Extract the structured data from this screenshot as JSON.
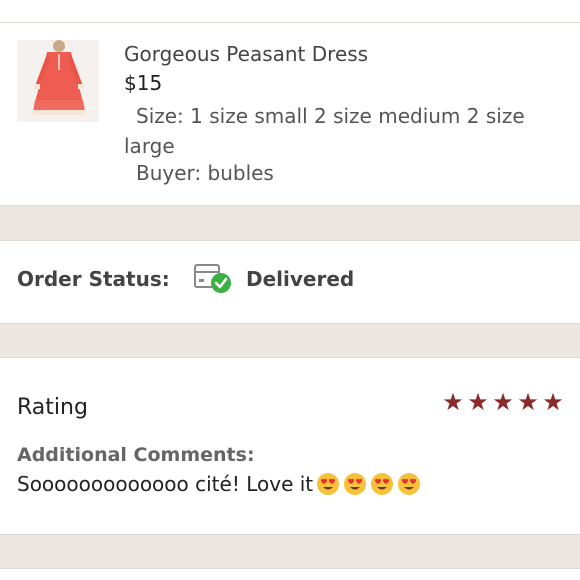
{
  "item": {
    "title": "Gorgeous Peasant Dress",
    "price": "$15",
    "size_line1": "Size: 1 size small 2 size medium 2 size",
    "size_line2": "large",
    "buyer": "Buyer: bubles"
  },
  "status": {
    "label": "Order Status:",
    "value": "Delivered",
    "icon": "package-delivered-icon",
    "accent": "#3cb043"
  },
  "rating": {
    "label": "Rating",
    "stars": 5,
    "star_color": "#8a2a2a",
    "comments_label": "Additional Comments:",
    "comments_text": "Sooooooooooooo cité! Love it",
    "emoji_count": 4,
    "emoji": "heart-eyes-emoji"
  }
}
